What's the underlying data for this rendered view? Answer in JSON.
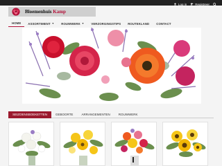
{
  "userbar": {
    "login_label": "Log in",
    "register_label": "Registreer"
  },
  "logo": {
    "name_part1": "Bloemenhuis ",
    "name_part2": "Kamp"
  },
  "nav": [
    {
      "label": "HOME",
      "dropdown": false
    },
    {
      "label": "ASSORTIMENT",
      "dropdown": true
    },
    {
      "label": "ROUWWERK",
      "dropdown": true
    },
    {
      "label": "VERZORGINGSTIPS",
      "dropdown": false
    },
    {
      "label": "ROUTEKLAND",
      "dropdown": false
    },
    {
      "label": "CONTACT",
      "dropdown": false
    }
  ],
  "tabs": [
    {
      "label": "SEIZOENSBOEKETTEN",
      "active": true
    },
    {
      "label": "GEBOORTE",
      "active": false
    },
    {
      "label": "ARRANGEMENTEN",
      "active": false
    },
    {
      "label": "ROUWWERK",
      "active": false
    }
  ],
  "colors": {
    "accent": "#9b1a2e",
    "topbar": "#222222"
  },
  "icons": {
    "login": "user-icon",
    "register": "user-plus-icon",
    "search": "search-icon"
  }
}
